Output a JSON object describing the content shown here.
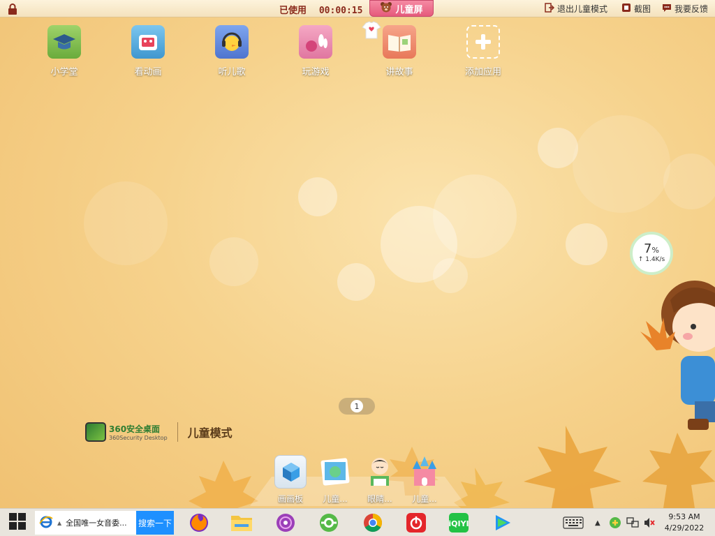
{
  "topbar": {
    "timer_label": "已使用",
    "timer_value": "00:00:15",
    "kid_screen": "儿童屏",
    "exit_label": "退出儿童模式",
    "screenshot_label": "截图",
    "feedback_label": "我要反馈"
  },
  "apps": [
    {
      "label": "小学堂"
    },
    {
      "label": "看动画"
    },
    {
      "label": "听儿歌"
    },
    {
      "label": "玩游戏"
    },
    {
      "label": "讲故事"
    },
    {
      "label": "添加应用"
    }
  ],
  "network": {
    "percent": "7",
    "unit": "%",
    "speed": "↑ 1.4K/s"
  },
  "pager": {
    "current": "1"
  },
  "brand": {
    "name": "360安全桌面",
    "sub": "360Security Desktop",
    "mode": "儿童模式"
  },
  "dock": [
    {
      "label": "画画板"
    },
    {
      "label": "儿童..."
    },
    {
      "label": "眼睛..."
    },
    {
      "label": "儿童..."
    }
  ],
  "taskbar": {
    "search_text": "全国唯一女音委...",
    "search_button": "搜索一下",
    "time": "9:53 AM",
    "date": "4/29/2022"
  },
  "colors": {
    "accent_pink": "#e55a7c",
    "search_blue": "#1e90ff"
  }
}
